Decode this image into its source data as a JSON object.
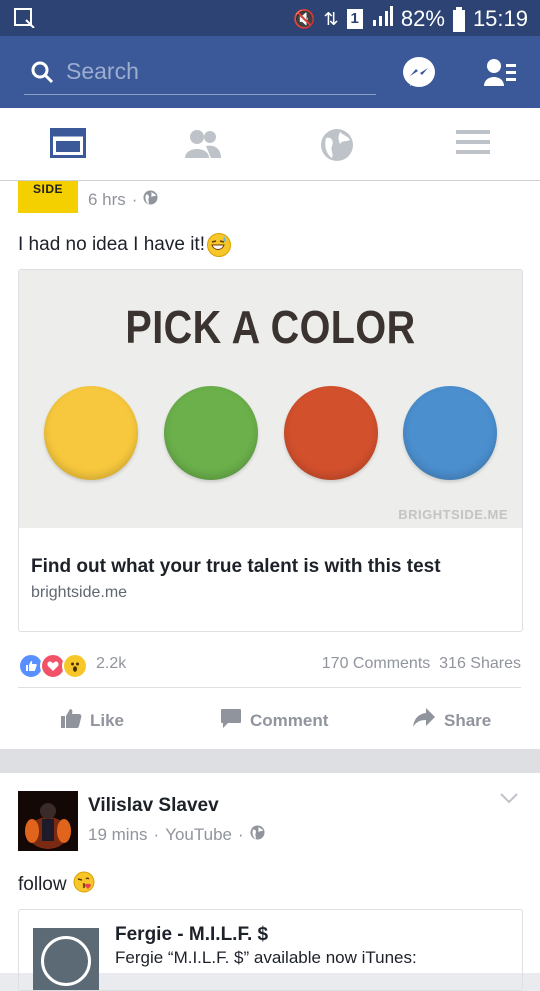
{
  "status_bar": {
    "signal_box": "1",
    "battery_percent": "82%",
    "time": "15:19"
  },
  "search": {
    "placeholder": "Search"
  },
  "post1": {
    "author_avatar_text": "SIDE",
    "time": "6 hrs",
    "text": "I had no idea I have it!",
    "link": {
      "image_title": "PICK A COLOR",
      "image_colors": [
        "#f7c83d",
        "#6bb04b",
        "#d3502d",
        "#4b8fcf"
      ],
      "image_source": "BRIGHTSIDE.ME",
      "title": "Find out what your true talent is with this test",
      "domain": "brightside.me"
    },
    "reaction_count": "2.2k",
    "comments": "170 Comments",
    "shares": "316 Shares",
    "actions": {
      "like": "Like",
      "comment": "Comment",
      "share": "Share"
    }
  },
  "post2": {
    "author": "Vilislav Slavev",
    "time": "19 mins",
    "via": "YouTube",
    "text": "follow",
    "link": {
      "title": "Fergie - M.I.L.F. $",
      "description": "Fergie “M.I.L.F. $” available now iTunes:"
    }
  }
}
